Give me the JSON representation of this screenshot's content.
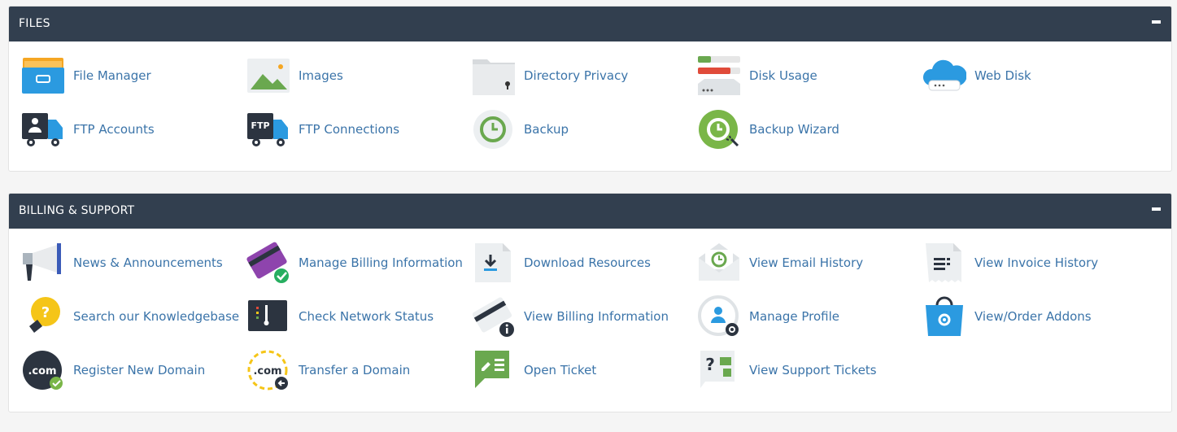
{
  "files": {
    "title": "FILES",
    "items": [
      {
        "label": "File Manager",
        "icon": "file-manager-icon"
      },
      {
        "label": "Images",
        "icon": "images-icon"
      },
      {
        "label": "Directory Privacy",
        "icon": "directory-privacy-icon"
      },
      {
        "label": "Disk Usage",
        "icon": "disk-usage-icon"
      },
      {
        "label": "Web Disk",
        "icon": "web-disk-icon"
      },
      {
        "label": "FTP Accounts",
        "icon": "ftp-accounts-icon"
      },
      {
        "label": "FTP Connections",
        "icon": "ftp-connections-icon"
      },
      {
        "label": "Backup",
        "icon": "backup-icon"
      },
      {
        "label": "Backup Wizard",
        "icon": "backup-wizard-icon"
      }
    ]
  },
  "billing": {
    "title": "BILLING & SUPPORT",
    "items": [
      {
        "label": "News & Announcements",
        "icon": "megaphone-icon"
      },
      {
        "label": "Manage Billing Information",
        "icon": "credit-card-check-icon"
      },
      {
        "label": "Download Resources",
        "icon": "download-icon"
      },
      {
        "label": "View Email History",
        "icon": "email-history-icon"
      },
      {
        "label": "View Invoice History",
        "icon": "invoice-icon"
      },
      {
        "label": "Search our Knowledgebase",
        "icon": "lightbulb-icon"
      },
      {
        "label": "Check Network Status",
        "icon": "network-status-icon"
      },
      {
        "label": "View Billing Information",
        "icon": "credit-card-info-icon"
      },
      {
        "label": "Manage Profile",
        "icon": "profile-gear-icon"
      },
      {
        "label": "View/Order Addons",
        "icon": "shopping-bag-icon"
      },
      {
        "label": "Register New Domain",
        "icon": "dotcom-check-icon"
      },
      {
        "label": "Transfer a Domain",
        "icon": "dotcom-transfer-icon"
      },
      {
        "label": "Open Ticket",
        "icon": "open-ticket-icon"
      },
      {
        "label": "View Support Tickets",
        "icon": "support-tickets-icon"
      }
    ]
  },
  "colors": {
    "header_bg": "#323f4f",
    "link": "#3b74a9",
    "green": "#7ab648",
    "blue": "#2b9ae0"
  }
}
